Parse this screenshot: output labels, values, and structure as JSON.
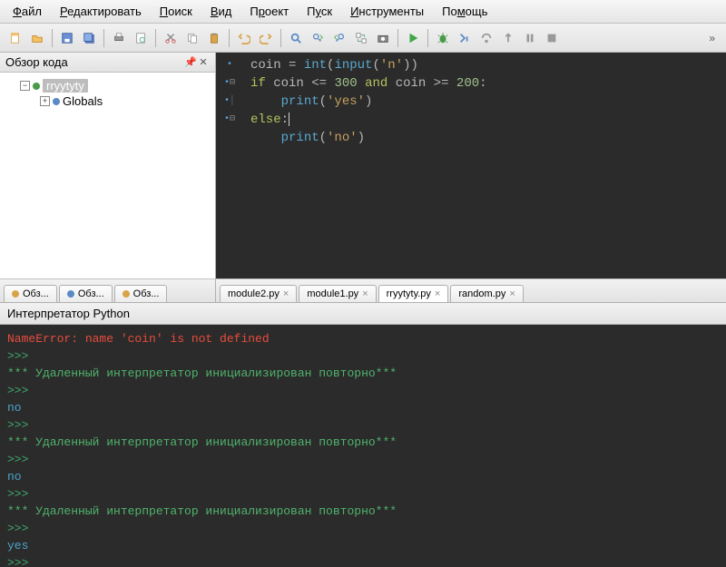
{
  "menu": {
    "items": [
      {
        "label": "Файл",
        "u": "Ф"
      },
      {
        "label": "Редактировать",
        "u": "Р"
      },
      {
        "label": "Поиск",
        "u": "П"
      },
      {
        "label": "Вид",
        "u": "В"
      },
      {
        "label": "Проект",
        "u": "р"
      },
      {
        "label": "Пуск",
        "u": "у"
      },
      {
        "label": "Инструменты",
        "u": "И"
      },
      {
        "label": "Помощь",
        "u": "м"
      }
    ]
  },
  "left_panel": {
    "title": "Обзор кода",
    "tree": {
      "root": "rryytyty",
      "child": "Globals"
    },
    "tabs": [
      "Обз...",
      "Обз...",
      "Обз..."
    ]
  },
  "editor": {
    "tabs": [
      {
        "label": "module2.py",
        "active": false
      },
      {
        "label": "module1.py",
        "active": false
      },
      {
        "label": "rryytyty.py",
        "active": true
      },
      {
        "label": "random.py",
        "active": false
      }
    ],
    "code": {
      "l1": {
        "a": "coin ",
        "b": "= ",
        "c": "int",
        "d": "(",
        "e": "input",
        "f": "(",
        "g": "'n'",
        "h": "))"
      },
      "l2": {
        "a": "if ",
        "b": "coin ",
        "c": "<= ",
        "d": "300",
        "e": " and ",
        "f": "coin ",
        "g": ">= ",
        "h": "200",
        "i": ":"
      },
      "l3": {
        "a": "    ",
        "b": "print",
        "c": "(",
        "d": "'yes'",
        "e": ")"
      },
      "l4": {
        "a": "else",
        "b": ":"
      },
      "l5": {
        "a": "    ",
        "b": "print",
        "c": "(",
        "d": "'no'",
        "e": ")"
      }
    }
  },
  "interpreter": {
    "title": "Интерпретатор Python",
    "lines": [
      {
        "cls": "c-err",
        "text": "NameError: name 'coin' is not defined"
      },
      {
        "cls": "c-prompt",
        "text": ">>> "
      },
      {
        "cls": "c-init",
        "text": "*** Удаленный интерпретатор инициализирован повторно***"
      },
      {
        "cls": "c-prompt",
        "text": ">>> "
      },
      {
        "cls": "c-out",
        "text": "no"
      },
      {
        "cls": "c-prompt",
        "text": ">>> "
      },
      {
        "cls": "c-init",
        "text": "*** Удаленный интерпретатор инициализирован повторно***"
      },
      {
        "cls": "c-prompt",
        "text": ">>> "
      },
      {
        "cls": "c-out",
        "text": "no"
      },
      {
        "cls": "c-prompt",
        "text": ">>> "
      },
      {
        "cls": "c-init",
        "text": "*** Удаленный интерпретатор инициализирован повторно***"
      },
      {
        "cls": "c-prompt",
        "text": ">>> "
      },
      {
        "cls": "c-out",
        "text": "yes"
      },
      {
        "cls": "c-prompt",
        "text": ">>> "
      }
    ]
  }
}
